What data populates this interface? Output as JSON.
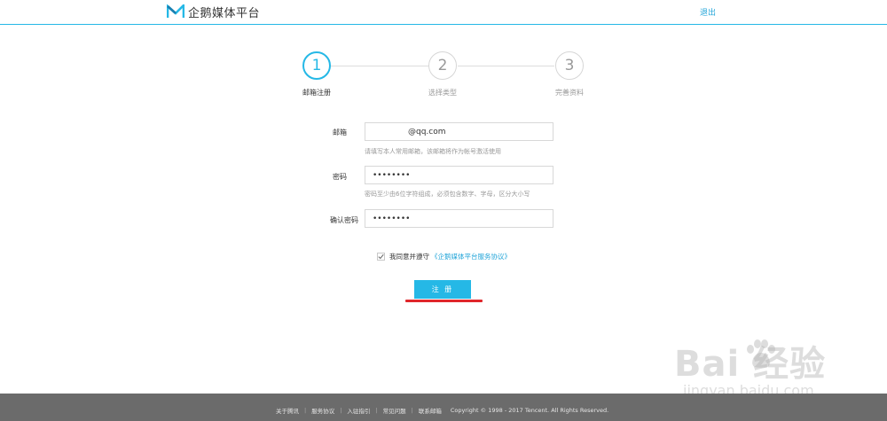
{
  "header": {
    "logo_text": "企鹅媒体平台",
    "logout_label": "退出"
  },
  "steps": [
    {
      "number": "1",
      "label": "邮箱注册",
      "active": true
    },
    {
      "number": "2",
      "label": "选择类型",
      "active": false
    },
    {
      "number": "3",
      "label": "完善资料",
      "active": false
    }
  ],
  "form": {
    "email": {
      "label": "邮箱",
      "value": "@qq.com",
      "hint": "请填写本人常用邮箱，该邮箱将作为帐号激活使用"
    },
    "password": {
      "label": "密码",
      "value": "••••••••",
      "hint": "密码至少由6位字符组成，必须包含数字、字母，区分大小写"
    },
    "confirm_password": {
      "label": "确认密码",
      "value": "••••••••"
    },
    "agreement": {
      "checked": true,
      "text": "我同意并遵守",
      "link_text": "《企鹅媒体平台服务协议》"
    },
    "register_label": "注 册"
  },
  "footer": {
    "links": [
      "关于腾讯",
      "服务协议",
      "入驻指引",
      "常见问题",
      "联系邮箱"
    ],
    "copyright": "Copyright © 1998 - 2017 Tencent. All Rights Reserved."
  },
  "watermark": {
    "main": "Bai  经验",
    "sub": "jingyan.baidu.com"
  },
  "colors": {
    "accent": "#25b8e6",
    "link": "#25a6d9",
    "annotation_red": "#e0262b",
    "footer_bg": "#6b6b6b"
  }
}
